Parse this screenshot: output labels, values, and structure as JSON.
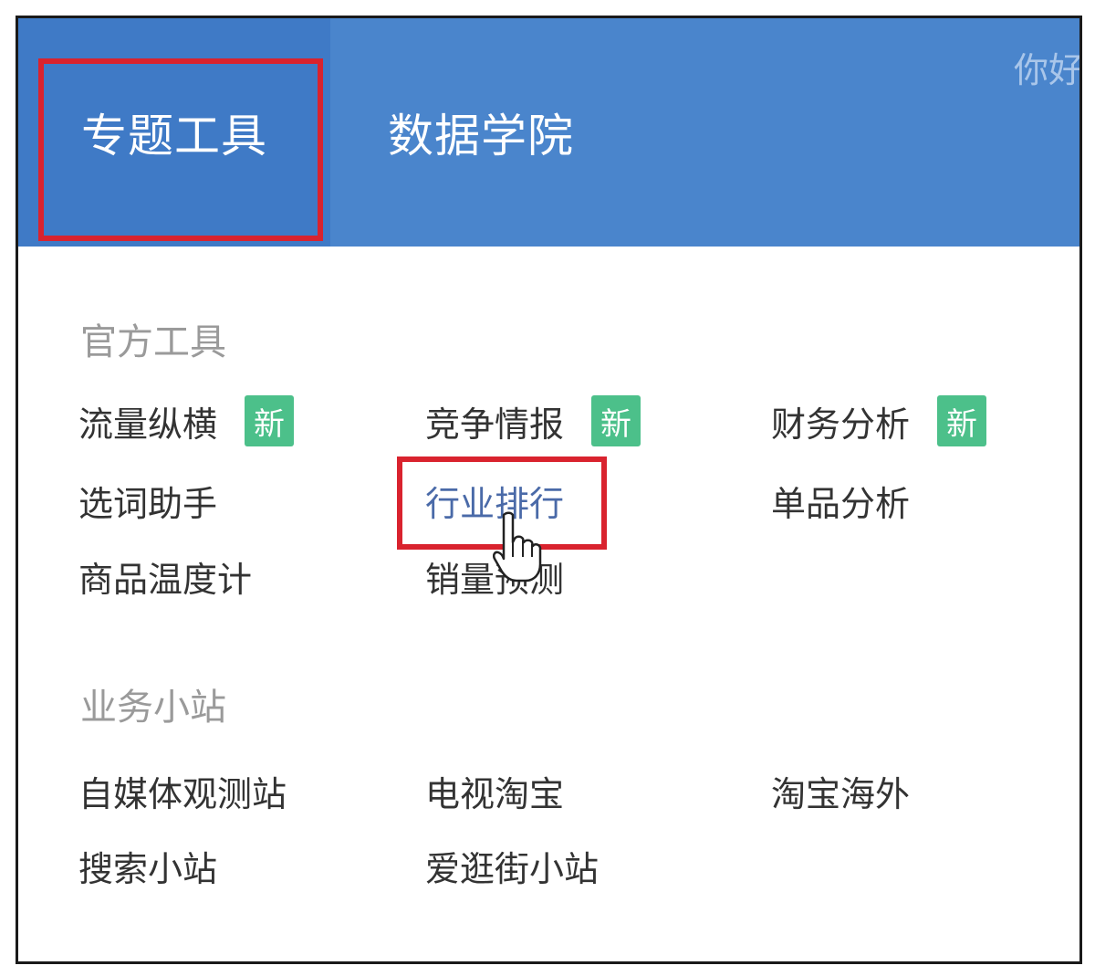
{
  "nav": {
    "tabs": [
      {
        "label": "专题工具",
        "active": true
      },
      {
        "label": "数据学院",
        "active": false
      }
    ],
    "greeting": "你好"
  },
  "sections": [
    {
      "title": "官方工具",
      "items": [
        {
          "label": "流量纵横",
          "badge": "新"
        },
        {
          "label": "竞争情报",
          "badge": "新"
        },
        {
          "label": "财务分析",
          "badge": "新"
        },
        {
          "label": "选词助手"
        },
        {
          "label": "行业排行",
          "hovered": true
        },
        {
          "label": "单品分析"
        },
        {
          "label": "商品温度计"
        },
        {
          "label": "销量预测"
        }
      ]
    },
    {
      "title": "业务小站",
      "items": [
        {
          "label": "自媒体观测站"
        },
        {
          "label": "电视淘宝"
        },
        {
          "label": "淘宝海外"
        },
        {
          "label": "搜索小站"
        },
        {
          "label": "爱逛街小站"
        }
      ]
    }
  ],
  "colors": {
    "nav_bg": "#4a85cc",
    "nav_active_bg": "#3f7ac6",
    "badge": "#4cc08a",
    "highlight": "#d9232e",
    "hover_text": "#4a6aa8"
  },
  "cursor_icon": "hand-pointer-icon"
}
